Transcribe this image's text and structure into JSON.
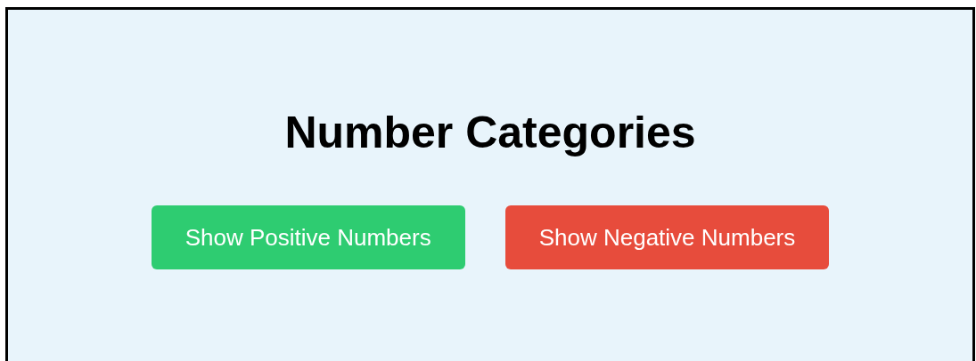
{
  "title": "Number Categories",
  "buttons": [
    {
      "label": "Show Positive Numbers",
      "color": "#2ecc71"
    },
    {
      "label": "Show Negative Numbers",
      "color": "#e74c3c"
    }
  ]
}
